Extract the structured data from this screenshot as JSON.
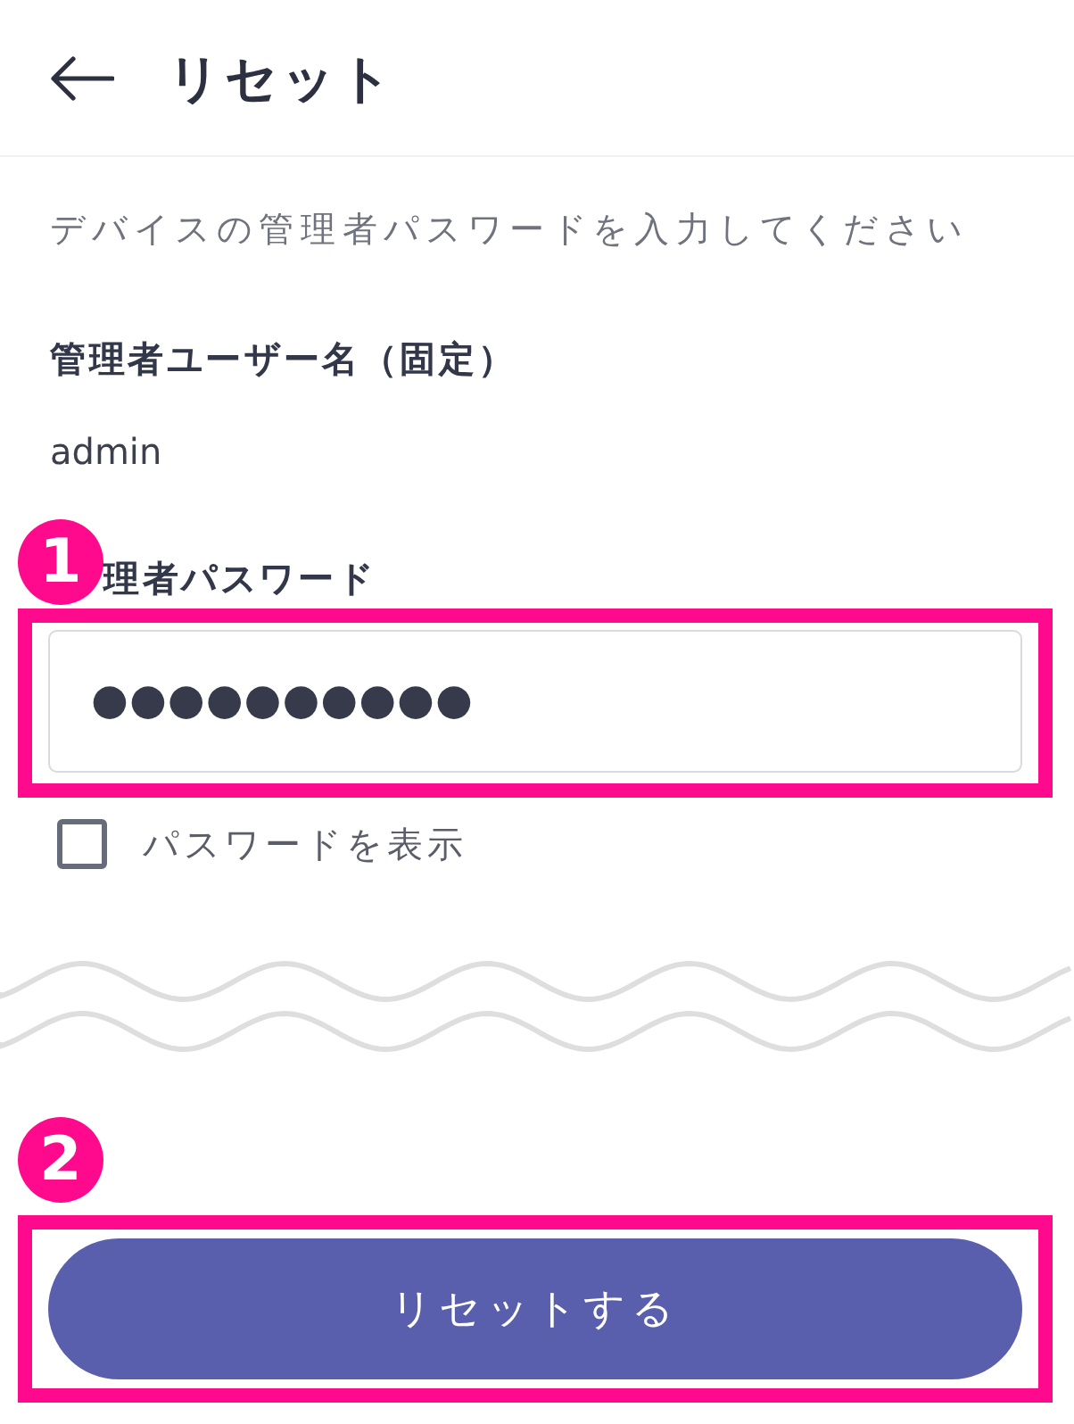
{
  "header": {
    "title": "リセット"
  },
  "description": "デバイスの管理者パスワードを入力してください",
  "username": {
    "label": "管理者ユーザー名（固定）",
    "value": "admin"
  },
  "password": {
    "badge": "1",
    "highlighted": true,
    "label": "理者パスワード",
    "value": "●●●●●●●●●●"
  },
  "show_password": {
    "label": "パスワードを表示",
    "checked": false
  },
  "submit": {
    "badge": "2",
    "highlighted": true,
    "label": "リセットする"
  }
}
